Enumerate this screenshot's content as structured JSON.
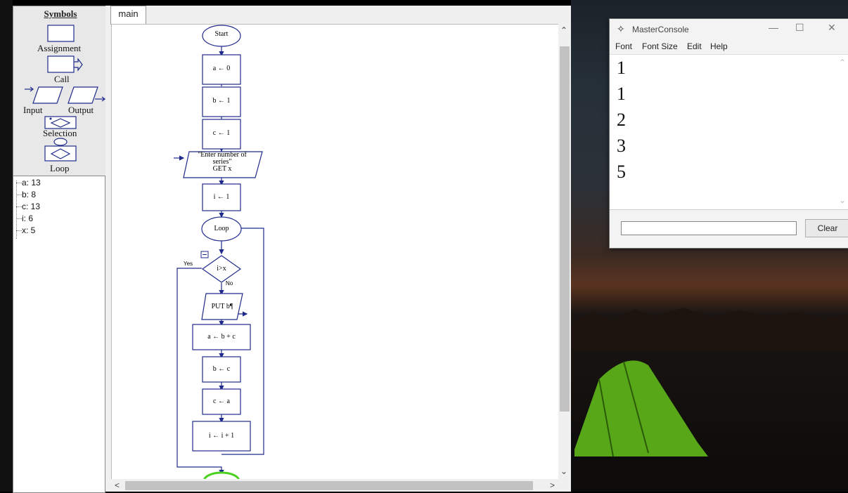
{
  "symbols_panel": {
    "title": "Symbols",
    "items": [
      {
        "label": "Assignment"
      },
      {
        "label": "Call"
      },
      {
        "label": "Input"
      },
      {
        "label": "Output"
      },
      {
        "label": "Selection"
      },
      {
        "label": "Loop"
      }
    ]
  },
  "variables": [
    {
      "text": "a: 13"
    },
    {
      "text": "b: 8"
    },
    {
      "text": "c: 13"
    },
    {
      "text": "i: 6"
    },
    {
      "text": "x: 5"
    }
  ],
  "tabs": [
    {
      "label": "main"
    }
  ],
  "flowchart": {
    "start": "Start",
    "steps": [
      "a ← 0",
      "b ← 1",
      "c ← 1"
    ],
    "input_prompt_1": "\"Enter number of",
    "input_prompt_2": "series\"",
    "input_get": "GET x",
    "init_i": "i ← 1",
    "loop": "Loop",
    "condition": "i>x",
    "yes_label": "Yes",
    "no_label": "No",
    "output": "PUT b¶",
    "body": [
      "a ← b + c",
      "b ← c",
      "c ← a",
      "i ← i + 1"
    ]
  },
  "console": {
    "title": "MasterConsole",
    "menu": [
      "Font",
      "Font Size",
      "Edit",
      "Help"
    ],
    "output_lines": [
      "1",
      "1",
      "2",
      "3",
      "5"
    ],
    "clear_label": "Clear",
    "input_value": ""
  },
  "colors": {
    "flow_stroke": "#1f2a8c",
    "loop_end_stroke": "#4bd11f",
    "canvas_bg": "#ffffff"
  }
}
